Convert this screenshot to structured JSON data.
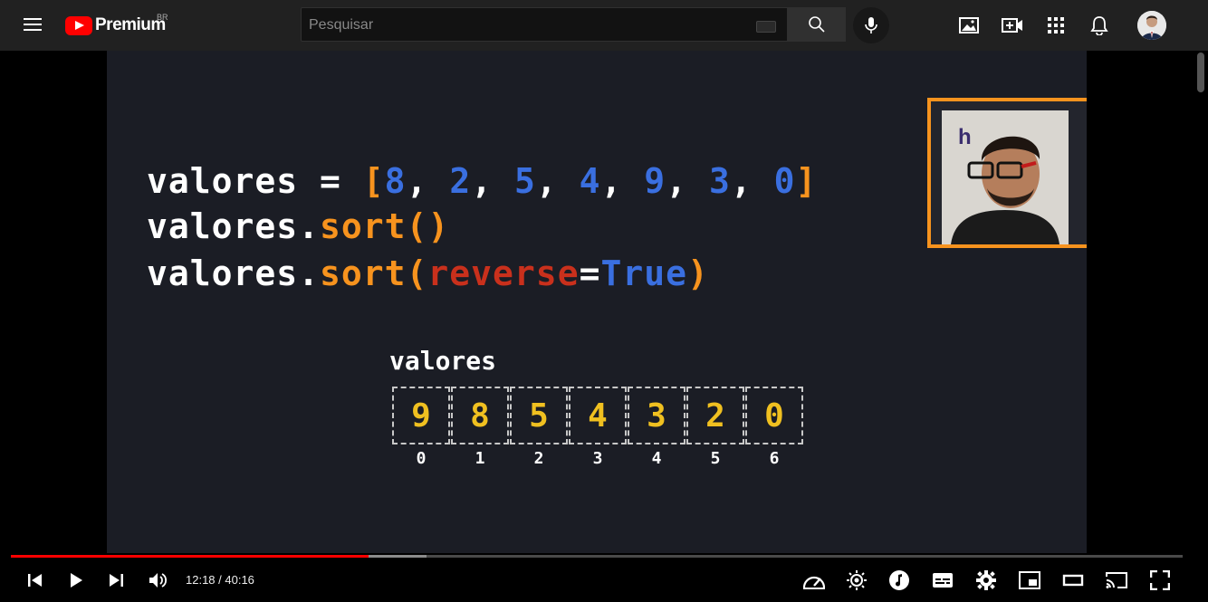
{
  "header": {
    "brand": "Premium",
    "country": "BR",
    "search_placeholder": "Pesquisar",
    "search_value": ""
  },
  "video": {
    "code_lines": [
      [
        {
          "t": "valores = ",
          "c": "white"
        },
        {
          "t": "[",
          "c": "orange"
        },
        {
          "t": "8",
          "c": "blue"
        },
        {
          "t": ", ",
          "c": "white"
        },
        {
          "t": "2",
          "c": "blue"
        },
        {
          "t": ", ",
          "c": "white"
        },
        {
          "t": "5",
          "c": "blue"
        },
        {
          "t": ", ",
          "c": "white"
        },
        {
          "t": "4",
          "c": "blue"
        },
        {
          "t": ", ",
          "c": "white"
        },
        {
          "t": "9",
          "c": "blue"
        },
        {
          "t": ", ",
          "c": "white"
        },
        {
          "t": "3",
          "c": "blue"
        },
        {
          "t": ", ",
          "c": "white"
        },
        {
          "t": "0",
          "c": "blue"
        },
        {
          "t": "]",
          "c": "orange"
        }
      ],
      [
        {
          "t": "valores.",
          "c": "white"
        },
        {
          "t": "sort()",
          "c": "orange"
        }
      ],
      [
        {
          "t": "valores.",
          "c": "white"
        },
        {
          "t": "sort(",
          "c": "orange"
        },
        {
          "t": "reverse",
          "c": "red"
        },
        {
          "t": "=",
          "c": "white"
        },
        {
          "t": "True",
          "c": "blue"
        },
        {
          "t": ")",
          "c": "orange"
        }
      ]
    ],
    "array_label": "valores",
    "array_values": [
      "9",
      "8",
      "5",
      "4",
      "3",
      "2",
      "0"
    ],
    "array_indices": [
      "0",
      "1",
      "2",
      "3",
      "4",
      "5",
      "6"
    ],
    "cam_logo_text": "h"
  },
  "player": {
    "current_time": "12:18",
    "duration": "40:16",
    "time_display": "12:18 / 40:16",
    "progress_played_fraction": 0.305,
    "progress_buffered_fraction": 0.355
  },
  "colors": {
    "brand_red": "#ff0000",
    "code_orange": "#f7931e",
    "code_blue": "#3a6fe0",
    "code_red": "#c9301c",
    "array_yellow": "#f0c020"
  }
}
